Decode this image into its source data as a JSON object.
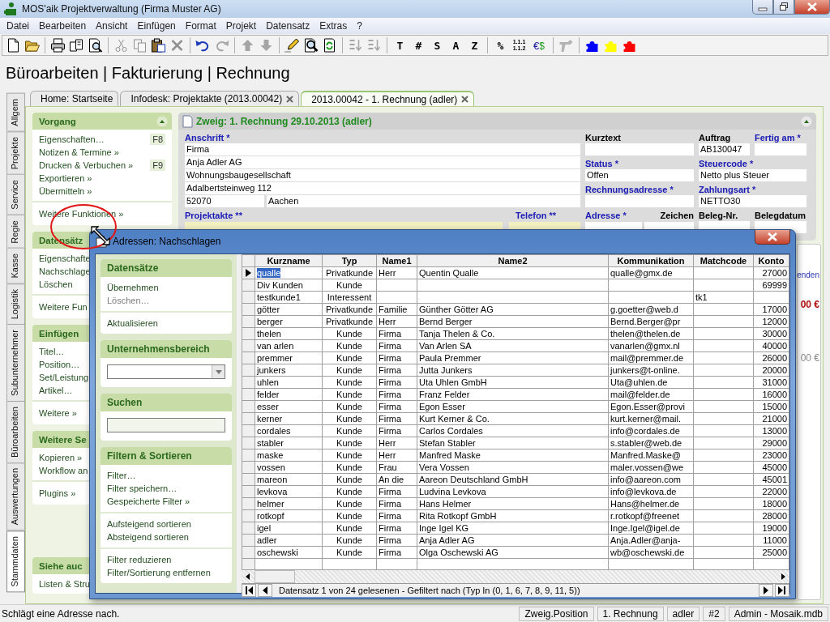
{
  "window": {
    "title": "MOS'aik Projektverwaltung (Firma Muster AG)"
  },
  "menu": [
    "Datei",
    "Bearbeiten",
    "Ansicht",
    "Einfügen",
    "Format",
    "Projekt",
    "Datensatz",
    "Extras",
    "?"
  ],
  "toolbar": [
    {
      "kind": "icon",
      "disabled": false
    },
    {
      "kind": "icon",
      "disabled": false
    },
    {
      "kind": "separator"
    },
    {
      "kind": "icon",
      "disabled": false
    },
    {
      "kind": "icon",
      "disabled": false
    },
    {
      "kind": "icon",
      "disabled": false
    },
    {
      "kind": "separator"
    },
    {
      "kind": "icon",
      "disabled": true
    },
    {
      "kind": "icon",
      "disabled": true
    },
    {
      "kind": "icon",
      "disabled": false
    },
    {
      "kind": "icon",
      "disabled": true
    },
    {
      "kind": "separator"
    },
    {
      "kind": "icon",
      "disabled": false
    },
    {
      "kind": "icon",
      "disabled": true
    },
    {
      "kind": "separator"
    },
    {
      "kind": "icon",
      "disabled": true
    },
    {
      "kind": "icon",
      "disabled": true
    },
    {
      "kind": "separator"
    },
    {
      "kind": "icon",
      "disabled": false
    },
    {
      "kind": "icon",
      "disabled": false
    },
    {
      "kind": "icon",
      "disabled": false
    },
    {
      "kind": "separator"
    },
    {
      "kind": "icon",
      "disabled": true
    },
    {
      "kind": "icon",
      "disabled": true
    },
    {
      "kind": "separator"
    },
    {
      "kind": "text",
      "label": "T"
    },
    {
      "kind": "text",
      "label": "#"
    },
    {
      "kind": "text",
      "label": "S"
    },
    {
      "kind": "text",
      "label": "A"
    },
    {
      "kind": "text",
      "label": "Z"
    },
    {
      "kind": "separator"
    },
    {
      "kind": "text",
      "label": "%"
    },
    {
      "kind": "numbering",
      "lines": [
        "1.1.1",
        "1.1.2"
      ]
    },
    {
      "kind": "currency",
      "label": "€$"
    },
    {
      "kind": "separator"
    },
    {
      "kind": "icon",
      "disabled": true
    },
    {
      "kind": "separator"
    },
    {
      "kind": "puzzle",
      "color": "#0000ff"
    },
    {
      "kind": "puzzle",
      "color": "#ffff00"
    },
    {
      "kind": "puzzle",
      "color": "#ff0000"
    }
  ],
  "heading": "Büroarbeiten | Fakturierung | Rechnung",
  "doc_tabs": [
    {
      "label": "Home: Startseite",
      "closable": false,
      "selected": false
    },
    {
      "label": "Infodesk: Projektakte (2013.00042)",
      "closable": true,
      "selected": false
    },
    {
      "label": "2013.00042 - 1. Rechnung (adler)",
      "closable": true,
      "selected": true
    }
  ],
  "side_tabs": [
    {
      "label": "Allgem",
      "selected": false
    },
    {
      "label": "Projekte",
      "selected": false
    },
    {
      "label": "Service",
      "selected": false
    },
    {
      "label": "Regie",
      "selected": false
    },
    {
      "label": "Kasse",
      "selected": false
    },
    {
      "label": "Logistik",
      "selected": false
    },
    {
      "label": "Subunternehmer",
      "selected": false
    },
    {
      "label": "Büroarbeiten",
      "selected": false
    },
    {
      "label": "Auswertungen",
      "selected": false
    },
    {
      "label": "Stammdaten",
      "selected": true
    }
  ],
  "task_panel": [
    {
      "title": "Vorgang",
      "collapsible": true,
      "groups": [
        [
          {
            "label": "Eigenschaften…",
            "shortcut": "F8"
          },
          {
            "label": "Notizen & Termine »"
          },
          {
            "label": "Drucken & Verbuchen »",
            "shortcut": "F9"
          },
          {
            "label": "Exportieren »"
          },
          {
            "label": "Übermitteln »"
          }
        ],
        [
          {
            "label": "Weitere Funktionen »"
          }
        ]
      ]
    },
    {
      "title": "Datensätz",
      "collapsible": false,
      "groups": [
        [
          {
            "label": "Eigenschafte"
          },
          {
            "label": "Nachschlage"
          },
          {
            "label": "Löschen"
          }
        ],
        [
          {
            "label": "Weitere Fun"
          }
        ]
      ]
    },
    {
      "title": "Einfügen",
      "collapsible": false,
      "groups": [
        [
          {
            "label": "Titel…"
          },
          {
            "label": "Position…"
          },
          {
            "label": "Set/Leistung"
          },
          {
            "label": "Artikel…"
          }
        ],
        [
          {
            "label": "Weitere »"
          }
        ]
      ]
    },
    {
      "title": "Weitere Se",
      "collapsible": false,
      "groups": [
        [
          {
            "label": "Kopieren »"
          },
          {
            "label": "Workflow an"
          }
        ],
        [
          {
            "label": "Plugins »"
          }
        ]
      ]
    },
    {
      "title": "Siehe auc",
      "collapsible": false,
      "groups": [
        [
          {
            "label": "Listen & Stru"
          }
        ]
      ]
    }
  ],
  "form": {
    "title": "Zweig: 1. Rechnung 29.10.2013 (adler)",
    "address_label": {
      "label": "Anschrift *",
      "required": true
    },
    "address_lines": [
      "Firma",
      "Anja Adler AG",
      "Wohnungsbaugesellschaft",
      "Adalbertsteinweg 112"
    ],
    "zip": "52070",
    "city": "Aachen",
    "fields": [
      {
        "label": "Kurztext",
        "required": false
      },
      {
        "label": "Auftrag",
        "required": false,
        "value": "AB130047"
      },
      {
        "label": "Fertig am *",
        "required": true
      },
      {
        "label": "Status *",
        "required": true,
        "value": "Offen"
      },
      {
        "label": "Steuercode *",
        "required": true,
        "value": "Netto plus Steuer"
      },
      {
        "label": "Rechnungsadresse *",
        "required": true
      },
      {
        "label": "Zahlungsart *",
        "required": true,
        "value": "NETTO30"
      }
    ],
    "lower_labels": [
      {
        "label": "Projektakte **",
        "required": true,
        "highlighted": true
      },
      {
        "label": "Telefon **",
        "required": true,
        "highlighted": true
      },
      {
        "label": "Adresse *",
        "required": true,
        "highlighted": false
      },
      {
        "label": "Zeichen",
        "required": false,
        "highlighted": false
      },
      {
        "label": "Beleg-Nr.",
        "required": false,
        "highlighted": false
      },
      {
        "label": "Belegdatum",
        "required": false,
        "highlighted": false
      }
    ]
  },
  "side_peek": {
    "link": "enden",
    "amount": "00 €",
    "amount_2": "00 €"
  },
  "dialog": {
    "title": "Adressen: Nachschlagen",
    "sections": [
      {
        "title": "Datensätze",
        "kind": "links",
        "groups": [
          [
            {
              "label": "Übernehmen",
              "disabled": false
            },
            {
              "label": "Löschen…",
              "disabled": true
            }
          ],
          [
            {
              "label": "Aktualisieren",
              "disabled": false
            }
          ]
        ]
      },
      {
        "title": "Unternehmensbereich",
        "kind": "dropdown"
      },
      {
        "title": "Suchen",
        "kind": "search"
      },
      {
        "title": "Filtern & Sortieren",
        "kind": "links",
        "groups": [
          [
            {
              "label": "Filter…",
              "disabled": false
            },
            {
              "label": "Filter speichern…",
              "disabled": false
            },
            {
              "label": "Gespeicherte Filter »",
              "disabled": false
            }
          ],
          [
            {
              "label": "Aufsteigend sortieren",
              "disabled": false
            },
            {
              "label": "Absteigend sortieren",
              "disabled": false
            }
          ],
          [
            {
              "label": "Filter reduzieren",
              "disabled": false
            },
            {
              "label": "Filter/Sortierung entfernen",
              "disabled": false
            }
          ]
        ]
      }
    ],
    "table": {
      "columns": [
        "Kurzname",
        "Typ",
        "Name1",
        "Name2",
        "Kommunikation",
        "Matchcode",
        "Konto"
      ],
      "rows": [
        {
          "selected": true,
          "cells": [
            "qualle",
            "Privatkunde",
            "Herr",
            "Quentin Qualle",
            "qualle@gmx.de",
            null,
            "27000"
          ]
        },
        {
          "selected": false,
          "cells": [
            "Div Kunden",
            "Kunde",
            null,
            null,
            null,
            null,
            "69999"
          ]
        },
        {
          "selected": false,
          "cells": [
            "testkunde1",
            "Interessent",
            null,
            null,
            null,
            "tk1",
            null
          ]
        },
        {
          "selected": false,
          "cells": [
            "götter",
            "Privatkunde",
            "Familie",
            "Günther Götter AG",
            "g.goetter@web.d",
            null,
            "17000"
          ]
        },
        {
          "selected": false,
          "cells": [
            "berger",
            "Privatkunde",
            "Herr",
            "Bernd Berger",
            "Bernd.Berger@pr",
            null,
            "12000"
          ]
        },
        {
          "selected": false,
          "cells": [
            "thelen",
            "Kunde",
            "Firma",
            "Tanja Thelen & Co.",
            "thelen@thelen.de",
            null,
            "30000"
          ]
        },
        {
          "selected": false,
          "cells": [
            "van arlen",
            "Kunde",
            "Firma",
            "Van Arlen SA",
            "vanarlen@gmx.nl",
            null,
            "40000"
          ]
        },
        {
          "selected": false,
          "cells": [
            "premmer",
            "Kunde",
            "Firma",
            "Paula Premmer",
            "mail@premmer.de",
            null,
            "26000"
          ]
        },
        {
          "selected": false,
          "cells": [
            "junkers",
            "Kunde",
            "Firma",
            "Jutta Junkers",
            "junkers@t-online.",
            null,
            "20000"
          ]
        },
        {
          "selected": false,
          "cells": [
            "uhlen",
            "Kunde",
            "Firma",
            "Uta Uhlen GmbH",
            "Uta@uhlen.de",
            null,
            "31000"
          ]
        },
        {
          "selected": false,
          "cells": [
            "felder",
            "Kunde",
            "Firma",
            "Franz Felder",
            "mail@felder.de",
            null,
            "16000"
          ]
        },
        {
          "selected": false,
          "cells": [
            "esser",
            "Kunde",
            "Firma",
            "Egon Esser",
            "Egon.Esser@provi",
            null,
            "15000"
          ]
        },
        {
          "selected": false,
          "cells": [
            "kerner",
            "Kunde",
            "Firma",
            "Kurt Kerner & Co.",
            "kurt.kerner@mail.",
            null,
            "21000"
          ]
        },
        {
          "selected": false,
          "cells": [
            "cordales",
            "Kunde",
            "Firma",
            "Carlos Cordales",
            "info@cordales.de",
            null,
            "13000"
          ]
        },
        {
          "selected": false,
          "cells": [
            "stabler",
            "Kunde",
            "Herr",
            "Stefan Stabler",
            "s.stabler@web.de",
            null,
            "29000"
          ]
        },
        {
          "selected": false,
          "cells": [
            "maske",
            "Kunde",
            "Herr",
            "Manfred Maske",
            "Manfred.Maske@",
            null,
            "23000"
          ]
        },
        {
          "selected": false,
          "cells": [
            "vossen",
            "Kunde",
            "Frau",
            "Vera Vossen",
            "maler.vossen@we",
            null,
            "45000"
          ]
        },
        {
          "selected": false,
          "cells": [
            "mareon",
            "Kunde",
            "An die",
            "Aareon Deutschland GmbH",
            "info@aareon.com",
            null,
            "45001"
          ]
        },
        {
          "selected": false,
          "cells": [
            "levkova",
            "Kunde",
            "Firma",
            "Ludvina Levkova",
            "info@levkova.de",
            null,
            "22000"
          ]
        },
        {
          "selected": false,
          "cells": [
            "helmer",
            "Kunde",
            "Firma",
            "Hans Helmer",
            "Hans@helmer.de",
            null,
            "18000"
          ]
        },
        {
          "selected": false,
          "cells": [
            "rotkopf",
            "Kunde",
            "Firma",
            "Rita Rotkopf GmbH",
            "r.rotkopf@freenet",
            null,
            "28000"
          ]
        },
        {
          "selected": false,
          "cells": [
            "igel",
            "Kunde",
            "Firma",
            "Inge Igel KG",
            "Inge.Igel@igel.de",
            null,
            "19000"
          ]
        },
        {
          "selected": false,
          "cells": [
            "adler",
            "Kunde",
            "Firma",
            "Anja Adler AG",
            "Anja.Adler@anja-",
            null,
            "11000"
          ]
        },
        {
          "selected": false,
          "cells": [
            "oschewski",
            "Kunde",
            "Firma",
            "Olga Oschewski AG",
            "wb@oschewski.de",
            null,
            "25000"
          ]
        }
      ]
    },
    "record_status": "Datensatz 1 von 24 gelesenen - Gefiltert nach (Typ In (0, 1, 6, 7, 8, 9, 11, 5))"
  },
  "status_bar": {
    "message": "Schlägt eine Adresse nach.",
    "panes": [
      "Zweig.Position",
      "1. Rechnung",
      "adler",
      "#2",
      "Admin - Mosaik.mdb"
    ]
  }
}
